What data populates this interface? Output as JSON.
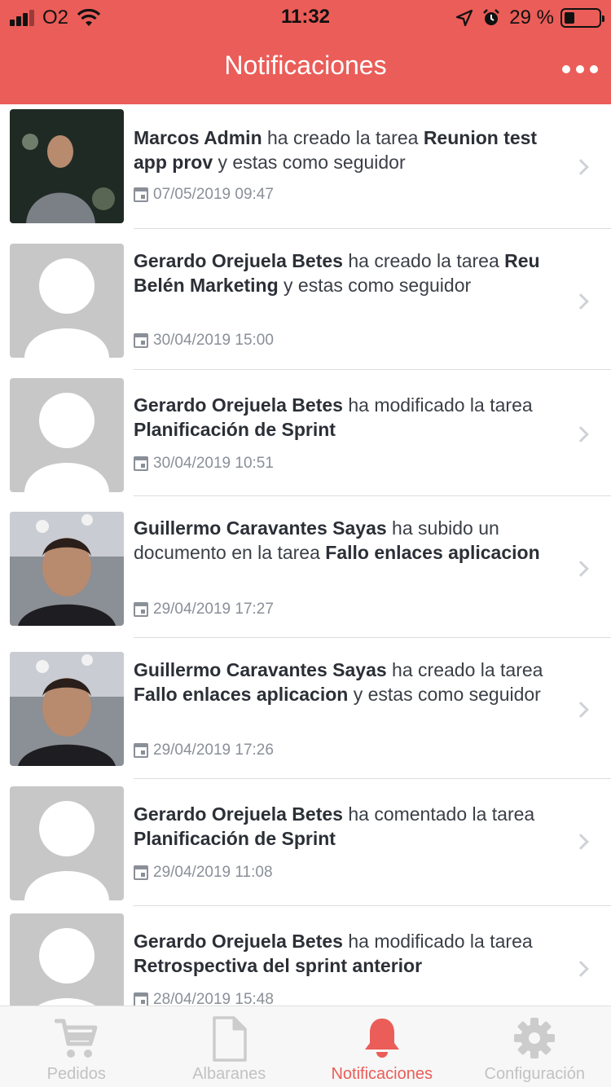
{
  "status_bar": {
    "carrier": "O2",
    "time": "11:32",
    "battery_percent": "29 %",
    "battery_level": 0.29,
    "icons": [
      "signal-icon",
      "wifi-icon",
      "location-arrow-icon",
      "alarm-icon",
      "battery-icon"
    ]
  },
  "header": {
    "title": "Notificaciones",
    "background": "#eb5d58",
    "more_icon": "ellipsis-icon"
  },
  "notifications": [
    {
      "avatar": "photo",
      "actor": "Marcos Admin",
      "action": " ha creado la tarea ",
      "task": "Reunion test app prov",
      "suffix": " y estas como seguidor",
      "date": "07/05/2019 09:47"
    },
    {
      "avatar": "placeholder",
      "actor": "Gerardo Orejuela Betes",
      "action": " ha creado la tarea ",
      "task": "Reu Belén Marketing",
      "suffix": " y estas como seguidor",
      "date": "30/04/2019 15:00"
    },
    {
      "avatar": "placeholder",
      "actor": "Gerardo Orejuela Betes",
      "action": " ha modificado la tarea ",
      "task": "Planificación de Sprint",
      "suffix": "",
      "date": "30/04/2019 10:51"
    },
    {
      "avatar": "photo",
      "actor": "Guillermo Caravantes Sayas",
      "action": " ha subido un documento en la tarea ",
      "task": "Fallo enlaces aplicacion",
      "suffix": "",
      "date": "29/04/2019 17:27"
    },
    {
      "avatar": "photo",
      "actor": "Guillermo Caravantes Sayas",
      "action": " ha creado la tarea ",
      "task": "Fallo enlaces aplicacion",
      "suffix": " y estas como seguidor",
      "date": "29/04/2019 17:26"
    },
    {
      "avatar": "placeholder",
      "actor": "Gerardo Orejuela Betes",
      "action": " ha comentado la tarea ",
      "task": "Planificación de Sprint",
      "suffix": "",
      "date": "29/04/2019 11:08"
    },
    {
      "avatar": "placeholder",
      "actor": "Gerardo Orejuela Betes",
      "action": " ha modificado la tarea ",
      "task": "Retrospectiva del sprint anterior",
      "suffix": "",
      "date": "28/04/2019 15:48"
    }
  ],
  "tabbar": {
    "tabs": [
      {
        "label": "Pedidos",
        "icon": "cart-icon",
        "active": false
      },
      {
        "label": "Albaranes",
        "icon": "document-icon",
        "active": false
      },
      {
        "label": "Notificaciones",
        "icon": "bell-icon",
        "active": true
      },
      {
        "label": "Configuración",
        "icon": "gear-icon",
        "active": false
      }
    ],
    "active_color": "#eb5d58",
    "inactive_color": "#c2c2c2"
  }
}
